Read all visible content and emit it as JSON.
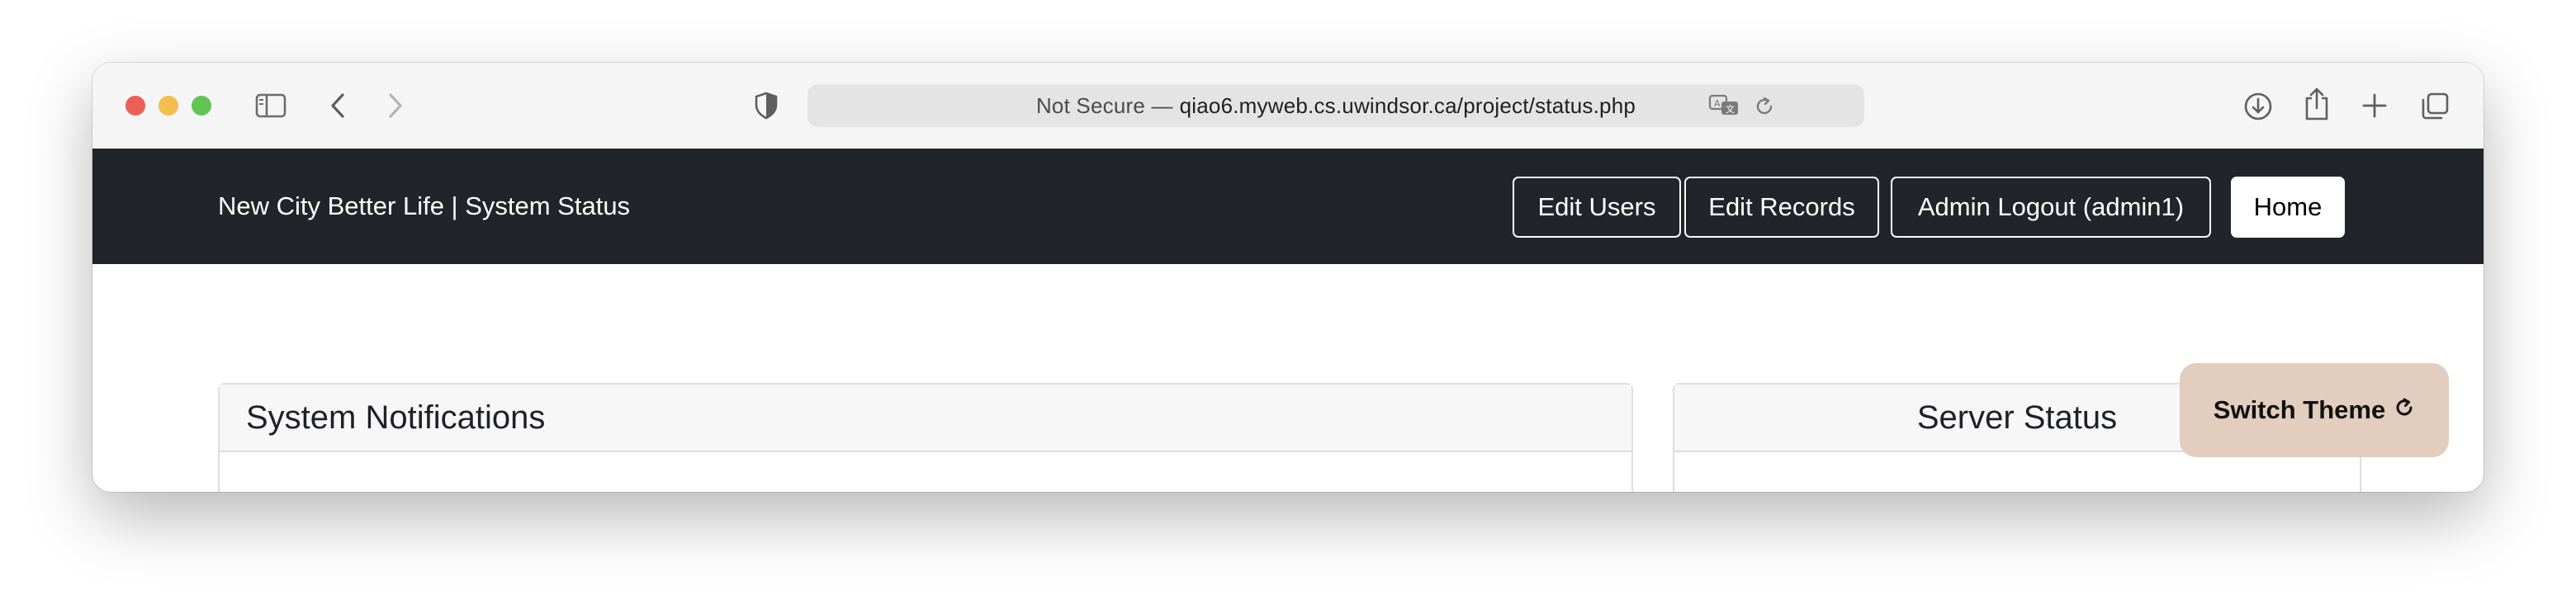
{
  "browser": {
    "address_prefix": "Not Secure —",
    "address_host": "qiao6.myweb.cs.uwindsor.ca/project/status.php",
    "icons": [
      "sidebar-icon",
      "back-icon",
      "forward-icon",
      "shield-icon",
      "translate-icon",
      "reload-icon",
      "download-icon",
      "share-icon",
      "new-tab-icon",
      "tab-overview-icon"
    ]
  },
  "navbar": {
    "brand": "New City Better Life | System Status",
    "buttons": {
      "edit_users": "Edit Users",
      "edit_records": "Edit Records",
      "admin_logout": "Admin Logout (admin1)",
      "home": "Home"
    }
  },
  "main": {
    "notifications_title": "System Notifications",
    "server_status_title": "Server Status",
    "switch_theme": "Switch Theme"
  },
  "colors": {
    "navbar_bg": "#212529",
    "theme_button_bg": "#e2cdbf"
  }
}
